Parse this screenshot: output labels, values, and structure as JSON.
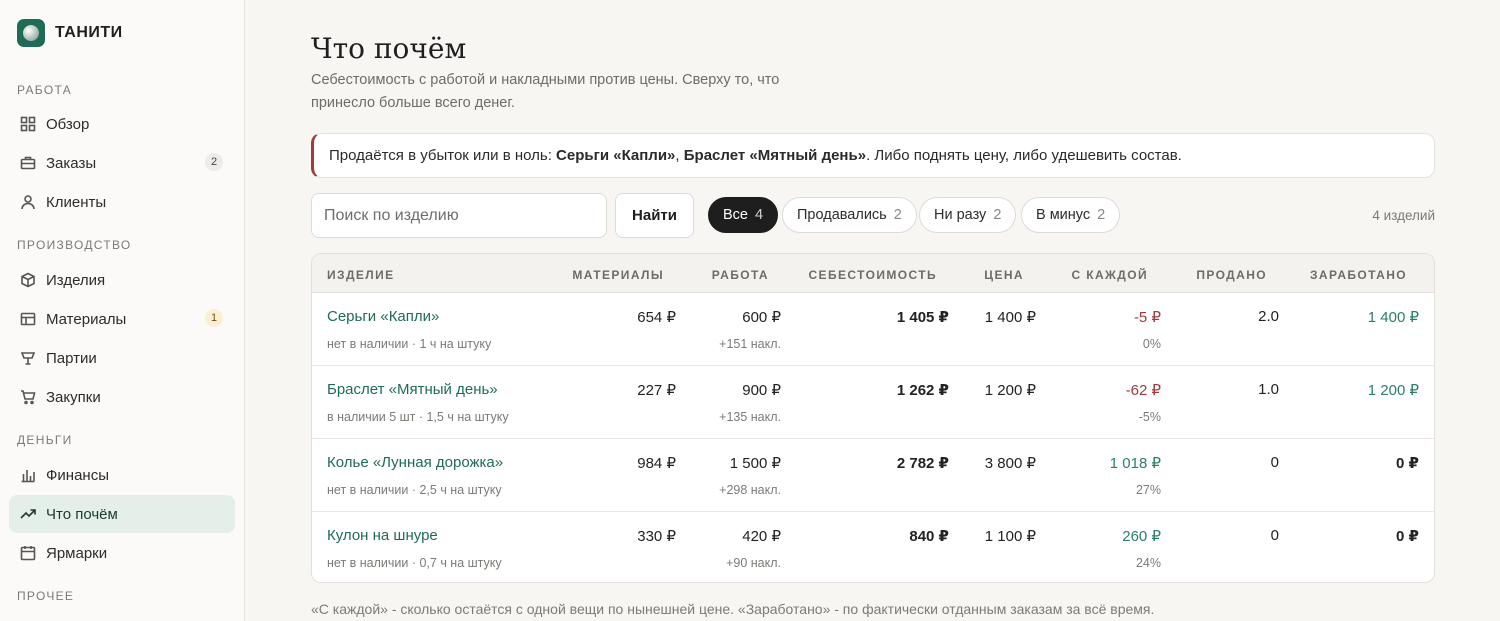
{
  "brand": {
    "name": "ТАНИТИ"
  },
  "sidebar": {
    "sections": [
      "РАБОТА",
      "ПРОИЗВОДСТВО",
      "ДЕНЬГИ",
      "ПРОЧЕЕ"
    ],
    "items": [
      {
        "label": "Обзор",
        "icon": "grid-icon"
      },
      {
        "label": "Заказы",
        "icon": "briefcase-icon",
        "badge": "2"
      },
      {
        "label": "Клиенты",
        "icon": "user-icon"
      },
      {
        "label": "Изделия",
        "icon": "box-icon"
      },
      {
        "label": "Материалы",
        "icon": "palette-icon",
        "badge": "1"
      },
      {
        "label": "Партии",
        "icon": "flask-icon"
      },
      {
        "label": "Закупки",
        "icon": "cart-icon"
      },
      {
        "label": "Финансы",
        "icon": "bar-chart-icon"
      },
      {
        "label": "Что почём",
        "icon": "trend-icon",
        "active": true
      },
      {
        "label": "Ярмарки",
        "icon": "calendar-icon"
      }
    ]
  },
  "page": {
    "title": "Что почём",
    "subtitle": "Себестоимость с работой и накладными против цены. Сверху то, что принесло больше всего денег."
  },
  "alert": {
    "prefix": "Продаётся в убыток или в ноль: ",
    "item1": "Серьги «Капли»",
    "sep": ", ",
    "item2": "Браслет «Мятный день»",
    "suffix": ". Либо поднять цену, либо удешевить состав."
  },
  "search": {
    "placeholder": "Поиск по изделию",
    "button": "Найти"
  },
  "filters": [
    {
      "label": "Все",
      "count": "4",
      "active": true
    },
    {
      "label": "Продавались",
      "count": "2"
    },
    {
      "label": "Ни разу",
      "count": "2"
    },
    {
      "label": "В минус",
      "count": "2"
    }
  ],
  "items_count": "4 изделий",
  "table": {
    "headers": [
      "ИЗДЕЛИЕ",
      "МАТЕРИАЛЫ",
      "РАБОТА",
      "СЕБЕСТОИМОСТЬ",
      "ЦЕНА",
      "С КАЖДОЙ",
      "ПРОДАНО",
      "ЗАРАБОТАНО"
    ],
    "rows": [
      {
        "name": "Серьги «Капли»",
        "meta": "нет в наличии · 1 ч на штуку",
        "materials": "654 ₽",
        "work": "600 ₽",
        "overhead": "+151 накл.",
        "cost": "1 405 ₽",
        "price": "1 400 ₽",
        "margin": "-5 ₽",
        "margin_pct": "0%",
        "sold": "2.0",
        "earned": "1 400 ₽"
      },
      {
        "name": "Браслет «Мятный день»",
        "meta": "в наличии 5 шт · 1,5 ч на штуку",
        "materials": "227 ₽",
        "work": "900 ₽",
        "overhead": "+135 накл.",
        "cost": "1 262 ₽",
        "price": "1 200 ₽",
        "margin": "-62 ₽",
        "margin_pct": "-5%",
        "sold": "1.0",
        "earned": "1 200 ₽"
      },
      {
        "name": "Колье «Лунная дорожка»",
        "meta": "нет в наличии · 2,5 ч на штуку",
        "materials": "984 ₽",
        "work": "1 500 ₽",
        "overhead": "+298 накл.",
        "cost": "2 782 ₽",
        "price": "3 800 ₽",
        "margin": "1 018 ₽",
        "margin_pct": "27%",
        "sold": "0",
        "earned": "0 ₽"
      },
      {
        "name": "Кулон на шнуре",
        "meta": "нет в наличии · 0,7 ч на штуку",
        "materials": "330 ₽",
        "work": "420 ₽",
        "overhead": "+90 накл.",
        "cost": "840 ₽",
        "price": "1 100 ₽",
        "margin": "260 ₽",
        "margin_pct": "24%",
        "sold": "0",
        "earned": "0 ₽"
      }
    ]
  },
  "footnote": "«С каждой» - сколько остаётся с одной вещи по нынешней цене. «Заработано» - по фактически отданным заказам за всё время.",
  "colors": {
    "accent": "#1f6b55",
    "negative": "#a13a3e",
    "positive": "#2b8063"
  }
}
